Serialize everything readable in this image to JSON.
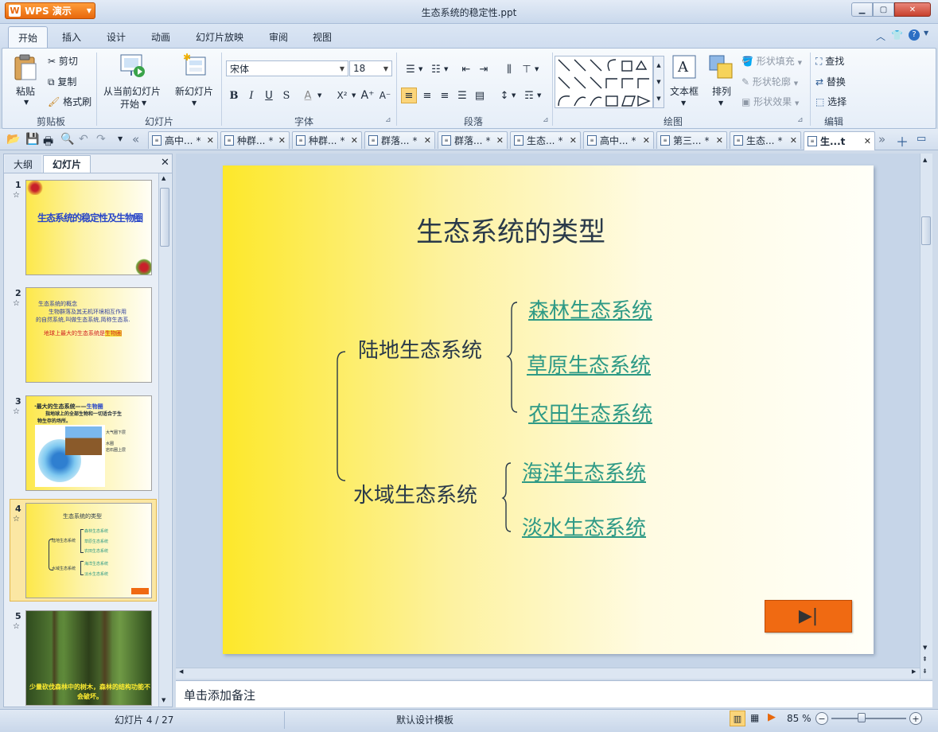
{
  "window": {
    "app_button": "WPS 演示",
    "title": "生态系统的稳定性.ppt"
  },
  "menu": {
    "tabs": [
      "开始",
      "插入",
      "设计",
      "动画",
      "幻灯片放映",
      "审阅",
      "视图"
    ]
  },
  "ribbon": {
    "clipboard": {
      "paste": "粘贴",
      "cut": "剪切",
      "copy": "复制",
      "format_painter": "格式刷",
      "group": "剪贴板"
    },
    "slides": {
      "from_current_1": "从当前幻灯片",
      "from_current_2": "开始",
      "new_slide": "新幻灯片",
      "group": "幻灯片"
    },
    "font": {
      "name": "宋体",
      "size": "18",
      "group": "字体"
    },
    "paragraph": {
      "group": "段落"
    },
    "drawing": {
      "textbox": "文本框",
      "arrange": "排列",
      "shape_fill": "形状填充",
      "shape_outline": "形状轮廓",
      "shape_effect": "形状效果",
      "group": "绘图"
    },
    "editing": {
      "find": "查找",
      "replace": "替换",
      "select": "选择",
      "group": "编辑"
    }
  },
  "doc_tabs": [
    "高中...",
    "种群...",
    "种群...",
    "群落...",
    "群落...",
    "生态...",
    "高中...",
    "第三...",
    "生态...",
    "生...t"
  ],
  "doc_tab_modified_marker": "*",
  "left_panel": {
    "tabs": [
      "大纲",
      "幻灯片"
    ],
    "active_tab": "幻灯片",
    "thumbs": [
      {
        "num": "1",
        "title": "生态系统的稳定性及生物圈"
      },
      {
        "num": "2",
        "line1": "生态系统的概念",
        "line2": "生物群落及其无机环境相互作用",
        "line3": "的自然系统,叫做生态系统,简称生态系.",
        "line4_plain": "地球上最大的生态系统是",
        "line4_hl": "生物圈"
      },
      {
        "num": "3",
        "line1": "·最大的生态系统——",
        "line1_hl": "生物圈",
        "line2": "指地球上的全部生物和一切适合于生",
        "line3": "物生存的场所。",
        "label1": "大气圈下层",
        "label2": "水圈",
        "label3": "岩石圈上层"
      },
      {
        "num": "4",
        "title": "生态系统的类型",
        "land": "陆地生态系统",
        "water": "水域生态系统",
        "items": [
          "森林生态系统",
          "草原生态系统",
          "农田生态系统",
          "海洋生态系统",
          "淡水生态系统"
        ]
      },
      {
        "num": "5",
        "caption": "少量砍伐森林中的树木，森林的结构功能不会破坏。"
      }
    ]
  },
  "slide": {
    "title": "生态系统的类型",
    "land": "陆地生态系统",
    "water": "水域生态系统",
    "land_items": [
      "森林生态系统",
      "草原生态系统",
      "农田生态系统"
    ],
    "water_items": [
      "海洋生态系统",
      "淡水生态系统"
    ],
    "next_button_glyph": "▶|"
  },
  "notes_placeholder": "单击添加备注",
  "status": {
    "slide_counter": "幻灯片 4 / 27",
    "template": "默认设计模板",
    "zoom": "85 %"
  },
  "colors": {
    "accent_orange": "#f06a12",
    "link_teal": "#2e9a86",
    "ribbon_blue": "#d0ddef"
  }
}
